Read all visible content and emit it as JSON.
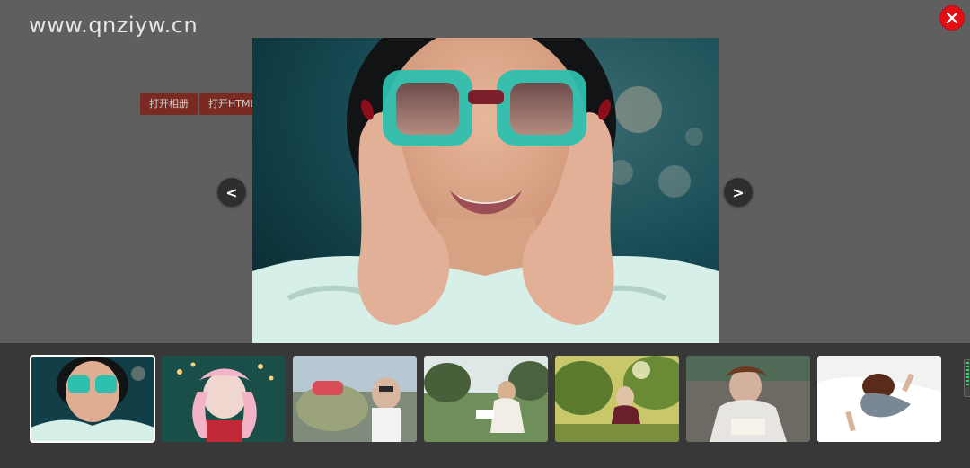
{
  "page": {
    "watermark": "www.qnziyw.cn",
    "buttons": [
      {
        "label": "打开相册"
      },
      {
        "label": "打开HTML"
      }
    ]
  },
  "lightbox": {
    "close_icon": "close-icon",
    "prev_label": "<",
    "next_label": ">",
    "thumbnails": [
      {
        "name": "thumb-1-glasses-woman",
        "active": true
      },
      {
        "name": "thumb-2-pink-hair-lights",
        "active": false
      },
      {
        "name": "thumb-3-beetle-car",
        "active": false
      },
      {
        "name": "thumb-4-reading-park",
        "active": false
      },
      {
        "name": "thumb-5-sunlit-trees",
        "active": false
      },
      {
        "name": "thumb-6-reading-book",
        "active": false
      },
      {
        "name": "thumb-7-sleeping-bed",
        "active": false
      }
    ]
  },
  "colors": {
    "overlay": "#5f5f5f",
    "strip": "#383838",
    "close": "#e20f14",
    "page_button": "#7a2a20"
  }
}
